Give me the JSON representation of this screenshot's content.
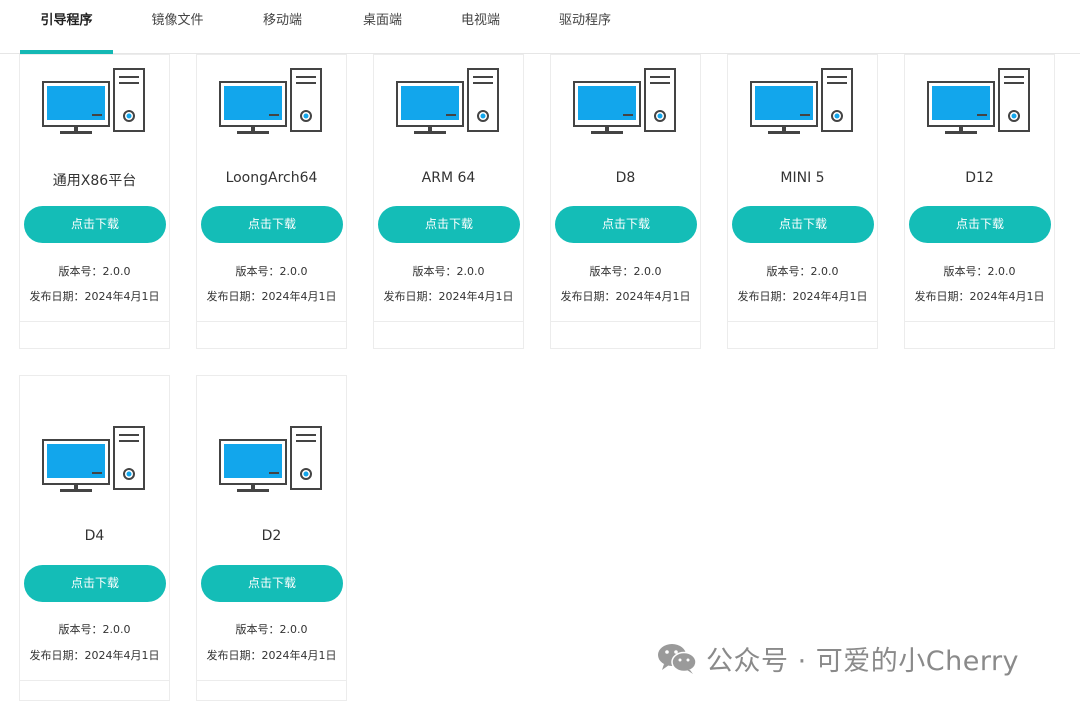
{
  "tabs": [
    {
      "label": "引导程序",
      "active": true
    },
    {
      "label": "镜像文件",
      "active": false
    },
    {
      "label": "移动端",
      "active": false
    },
    {
      "label": "桌面端",
      "active": false
    },
    {
      "label": "电视端",
      "active": false
    },
    {
      "label": "驱动程序",
      "active": false
    }
  ],
  "download_label": "点击下载",
  "cards": [
    {
      "name": "通用X86平台",
      "version": "版本号：2.0.0",
      "date": "发布日期：2024年4月1日"
    },
    {
      "name": "LoongArch64",
      "version": "版本号：2.0.0",
      "date": "发布日期：2024年4月1日"
    },
    {
      "name": "ARM 64",
      "version": "版本号：2.0.0",
      "date": "发布日期：2024年4月1日"
    },
    {
      "name": "D8",
      "version": "版本号：2.0.0",
      "date": "发布日期：2024年4月1日"
    },
    {
      "name": "MINI 5",
      "version": "版本号：2.0.0",
      "date": "发布日期：2024年4月1日"
    },
    {
      "name": "D12",
      "version": "版本号：2.0.0",
      "date": "发布日期：2024年4月1日"
    },
    {
      "name": "D4",
      "version": "版本号：2.0.0",
      "date": "发布日期：2024年4月1日"
    },
    {
      "name": "D2",
      "version": "版本号：2.0.0",
      "date": "发布日期：2024年4月1日"
    }
  ],
  "watermark": {
    "text": "公众号 · 可爱的小Cherry",
    "icon": "wechat-icon"
  },
  "colors": {
    "accent": "#14bdb7",
    "screen": "#12a6ec",
    "outline": "#444444"
  }
}
